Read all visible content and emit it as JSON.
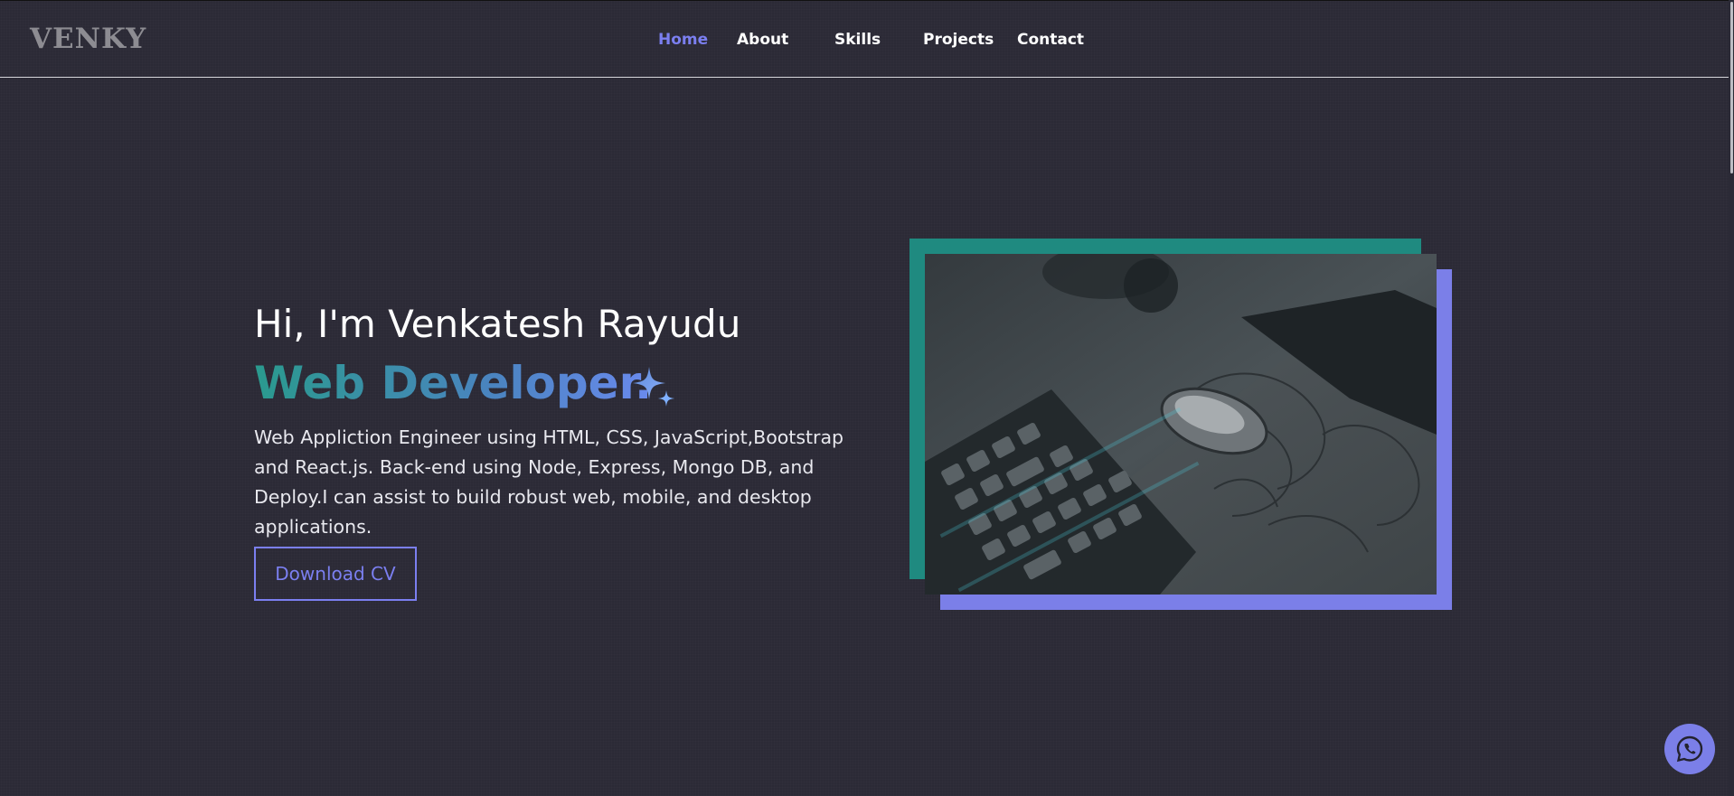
{
  "header": {
    "logo": "VENKY",
    "nav": [
      {
        "label": "Home",
        "active": true
      },
      {
        "label": "About",
        "active": false
      },
      {
        "label": "Skills",
        "active": false
      },
      {
        "label": "Projects",
        "active": false
      },
      {
        "label": "Contact",
        "active": false
      }
    ]
  },
  "hero": {
    "greeting": "Hi, I'm Venkatesh Rayudu",
    "role": "Web Developer.",
    "description": "Web Appliction Engineer using HTML, CSS, JavaScript,Bootstrap and React.js. Back-end using Node, Express, Mongo DB, and Deploy.I can assist to build robust web, mobile, and desktop applications.",
    "cta_label": "Download CV",
    "image_icon": "keyboard-mouse-photo"
  },
  "floating": {
    "whatsapp_icon": "whatsapp-icon"
  },
  "colors": {
    "background": "#2b2a36",
    "accent": "#7b7ff0",
    "teal": "#1f8a80",
    "purple_frame": "#7b7fe8"
  }
}
